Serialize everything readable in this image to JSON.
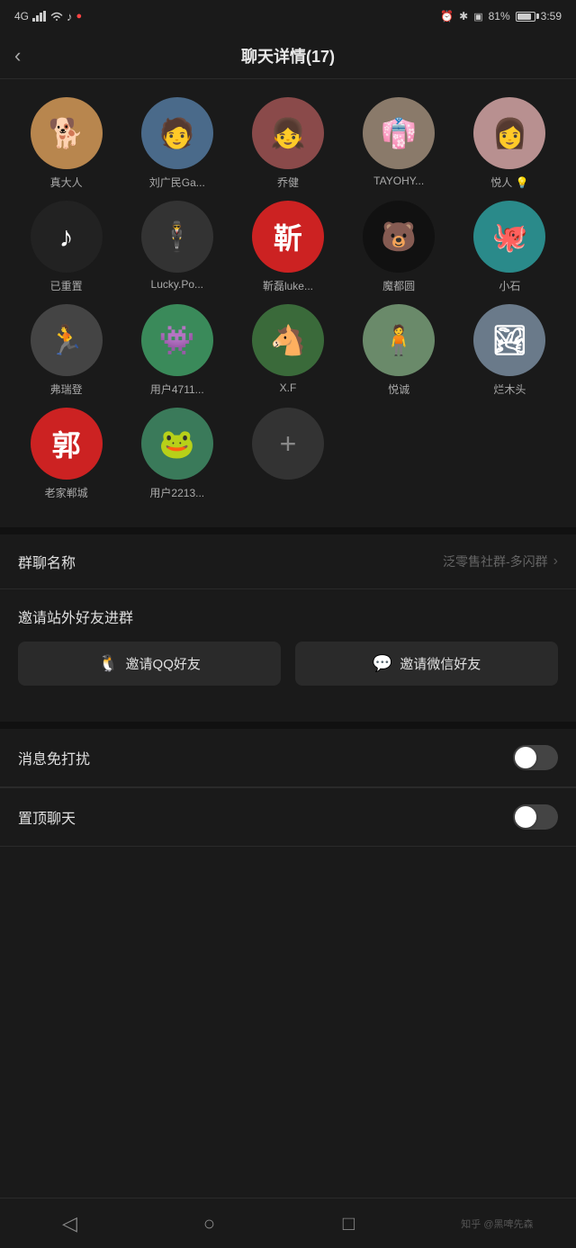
{
  "statusBar": {
    "signal": "4G",
    "time": "3:59",
    "battery": "81%",
    "icons": [
      "alarm",
      "bluetooth",
      "screenshot",
      "battery"
    ]
  },
  "header": {
    "back": "‹",
    "title": "聊天详情(17)"
  },
  "members": [
    {
      "id": 1,
      "name": "真大人",
      "avatarClass": "av-dog",
      "text": "🐕"
    },
    {
      "id": 2,
      "name": "刘广民Ga...",
      "avatarClass": "av-person1",
      "text": "👤"
    },
    {
      "id": 3,
      "name": "乔健",
      "avatarClass": "av-person2",
      "text": "👧"
    },
    {
      "id": 4,
      "name": "TAYOHY...",
      "avatarClass": "av-classical",
      "text": "👘"
    },
    {
      "id": 5,
      "name": "悦人 💡",
      "avatarClass": "av-woman1",
      "text": "👩"
    },
    {
      "id": 6,
      "name": "已重置",
      "avatarClass": "av-tiktok",
      "text": "🎵"
    },
    {
      "id": 7,
      "name": "Lucky.Po...",
      "avatarClass": "av-suit",
      "text": "🕴"
    },
    {
      "id": 8,
      "name": "靳磊luke...",
      "avatarClass": "av-red-char",
      "text": "靳"
    },
    {
      "id": 9,
      "name": "魔都圆",
      "avatarClass": "av-bear",
      "text": "🐻"
    },
    {
      "id": 10,
      "name": "小石",
      "avatarClass": "av-teal",
      "text": "🐙"
    },
    {
      "id": 11,
      "name": "弗瑞登",
      "avatarClass": "av-runner",
      "text": "🏃"
    },
    {
      "id": 12,
      "name": "用户4711...",
      "avatarClass": "av-green-monster",
      "text": "👾"
    },
    {
      "id": 13,
      "name": "X.F",
      "avatarClass": "av-horse",
      "text": "🐴"
    },
    {
      "id": 14,
      "name": "悦诚",
      "avatarClass": "av-outdoor",
      "text": "🧍"
    },
    {
      "id": 15,
      "name": "烂木头",
      "avatarClass": "av-landscape",
      "text": "🏞"
    },
    {
      "id": 16,
      "name": "老家郸城",
      "avatarClass": "av-郭",
      "text": "郭"
    },
    {
      "id": 17,
      "name": "用户2213...",
      "avatarClass": "av-frog",
      "text": "🐸"
    }
  ],
  "addButton": "+",
  "settings": {
    "groupName": {
      "label": "群聊名称",
      "value": "泛零售社群-多闪群"
    },
    "invite": {
      "label": "邀请站外好友进群",
      "qqButton": "邀请QQ好友",
      "wechatButton": "邀请微信好友"
    },
    "dnd": {
      "label": "消息免打扰",
      "enabled": false
    },
    "pinChat": {
      "label": "置顶聊天",
      "enabled": false
    }
  },
  "bottomNav": {
    "back": "◁",
    "home": "○",
    "recent": "□",
    "watermark": "知乎 @黑啤先森"
  }
}
